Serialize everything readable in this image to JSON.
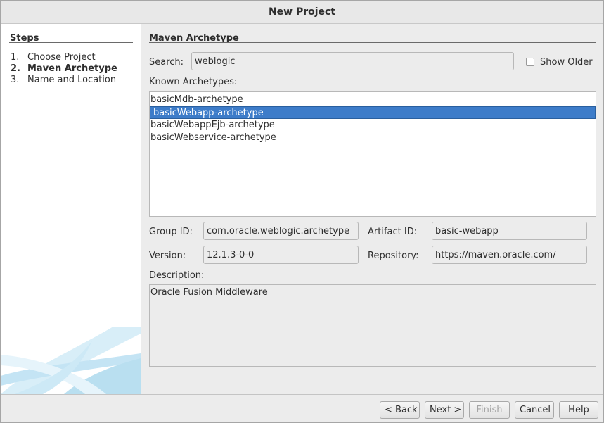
{
  "window": {
    "title": "New Project"
  },
  "steps": {
    "title": "Steps",
    "items": [
      {
        "num": "1.",
        "label": "Choose Project"
      },
      {
        "num": "2.",
        "label": "Maven Archetype"
      },
      {
        "num": "3.",
        "label": "Name and Location"
      }
    ],
    "current_index": 1
  },
  "panel": {
    "title": "Maven Archetype",
    "search_label": "Search:",
    "search_value": "weblogic",
    "show_older_label": "Show Older",
    "show_older_checked": false,
    "known_archetypes_label": "Known Archetypes:",
    "archetypes": [
      "basicMdb-archetype",
      "basicWebapp-archetype",
      "basicWebappEjb-archetype",
      "basicWebservice-archetype"
    ],
    "selected_index": 1,
    "group_id_label": "Group ID:",
    "group_id_value": "com.oracle.weblogic.archetype",
    "artifact_id_label": "Artifact ID:",
    "artifact_id_value": "basic-webapp",
    "version_label": "Version:",
    "version_value": "12.1.3-0-0",
    "repository_label": "Repository:",
    "repository_value": "https://maven.oracle.com/",
    "description_label": "Description:",
    "description_value": "Oracle Fusion Middleware"
  },
  "buttons": {
    "back": "< Back",
    "next": "Next >",
    "finish": "Finish",
    "cancel": "Cancel",
    "help": "Help"
  },
  "colors": {
    "selection": "#3d7cc9",
    "decor": "#b9dff0"
  }
}
